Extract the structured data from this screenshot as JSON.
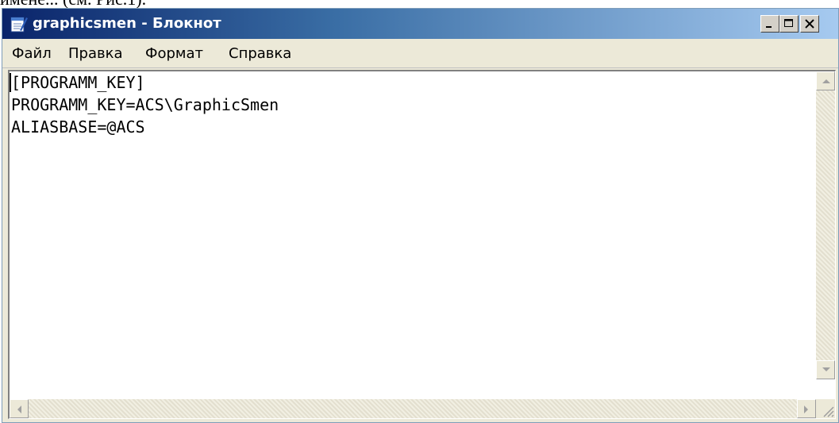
{
  "document": {
    "fragment": "имене...  (см. Рис.1)."
  },
  "window": {
    "title": "graphicsmen - Блокнот",
    "icon": "notepad-icon"
  },
  "menu": {
    "items": [
      "Файл",
      "Правка",
      "Формат",
      "Справка"
    ]
  },
  "editor": {
    "content": "[PROGRAMM_KEY]\nPROGRAMM_KEY=ACS\\GraphicSmen\nALIASBASE=@ACS"
  },
  "colors": {
    "titlebar_start": "#0a246a",
    "titlebar_end": "#a6caf0",
    "face": "#ece9d8"
  }
}
